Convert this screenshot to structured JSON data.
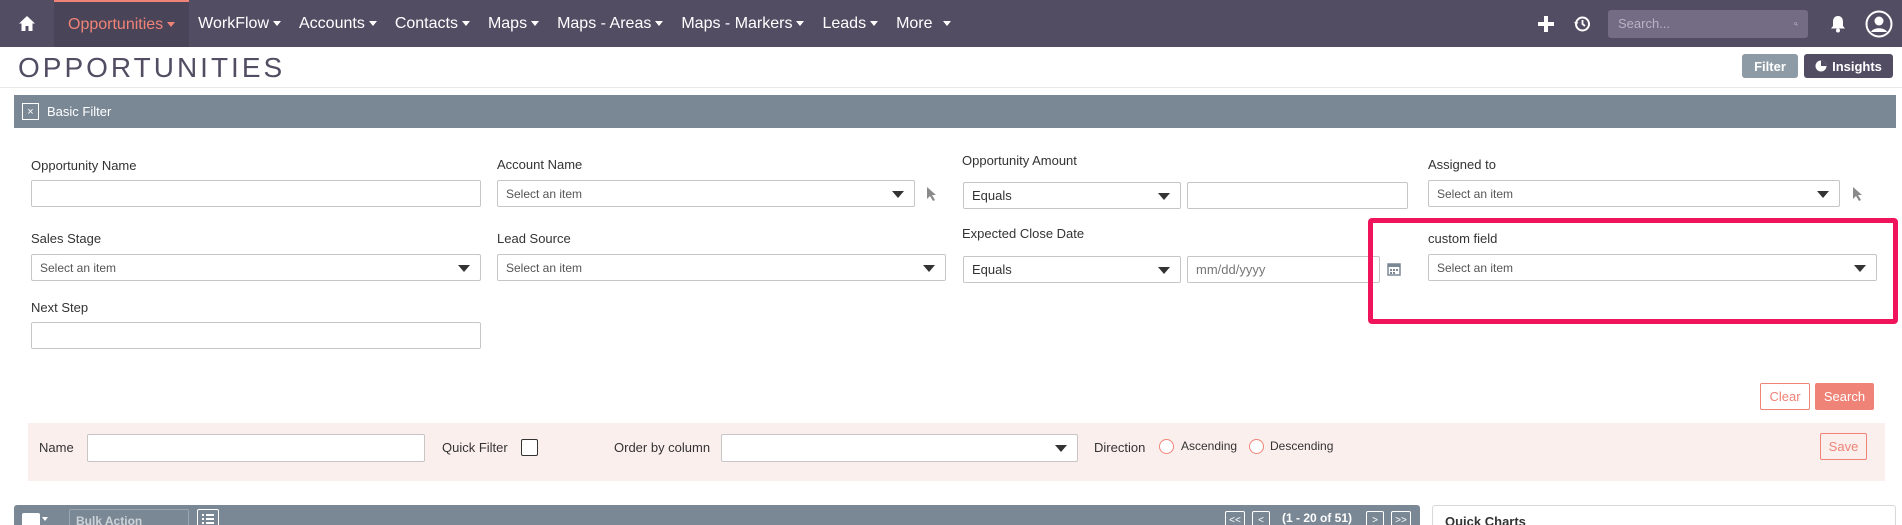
{
  "nav": {
    "items": [
      {
        "label": "Opportunities",
        "active": true
      },
      {
        "label": "WorkFlow"
      },
      {
        "label": "Accounts"
      },
      {
        "label": "Contacts"
      },
      {
        "label": "Maps"
      },
      {
        "label": "Maps - Areas"
      },
      {
        "label": "Maps - Markers"
      },
      {
        "label": "Leads"
      },
      {
        "label": "More"
      }
    ],
    "search_placeholder": "Search..."
  },
  "page": {
    "title": "OPPORTUNITIES",
    "filter_button": "Filter",
    "insights_button": "Insights"
  },
  "filter": {
    "header": "Basic Filter",
    "close_glyph": "×",
    "opportunity_name": {
      "label": "Opportunity Name",
      "value": ""
    },
    "account_name": {
      "label": "Account Name",
      "placeholder": "Select an item"
    },
    "opportunity_amount": {
      "label": "Opportunity Amount",
      "operator": "Equals",
      "value": ""
    },
    "assigned_to": {
      "label": "Assigned to",
      "placeholder": "Select an item"
    },
    "sales_stage": {
      "label": "Sales Stage",
      "placeholder": "Select an item"
    },
    "lead_source": {
      "label": "Lead Source",
      "placeholder": "Select an item"
    },
    "expected_close_date": {
      "label": "Expected Close Date",
      "operator": "Equals",
      "placeholder": "mm/dd/yyyy"
    },
    "custom_field": {
      "label": "custom field",
      "placeholder": "Select an item"
    },
    "next_step": {
      "label": "Next Step",
      "value": ""
    },
    "clear_button": "Clear",
    "search_button": "Search"
  },
  "saved_search": {
    "name_label": "Name",
    "quick_filter_label": "Quick Filter",
    "order_by_label": "Order by column",
    "direction_label": "Direction",
    "ascending_label": "Ascending",
    "descending_label": "Descending",
    "save_button": "Save"
  },
  "list": {
    "bulk_action": "Bulk Action",
    "page_first": "<<",
    "page_prev": "<",
    "pagination": "(1 - 20 of 51)",
    "page_next": ">",
    "page_last": ">>",
    "quick_charts": "Quick Charts"
  },
  "colors": {
    "nav_bg": "#534d64",
    "accent": "#f08377",
    "filter_header": "#7a8895",
    "highlight": "#f0145c"
  }
}
